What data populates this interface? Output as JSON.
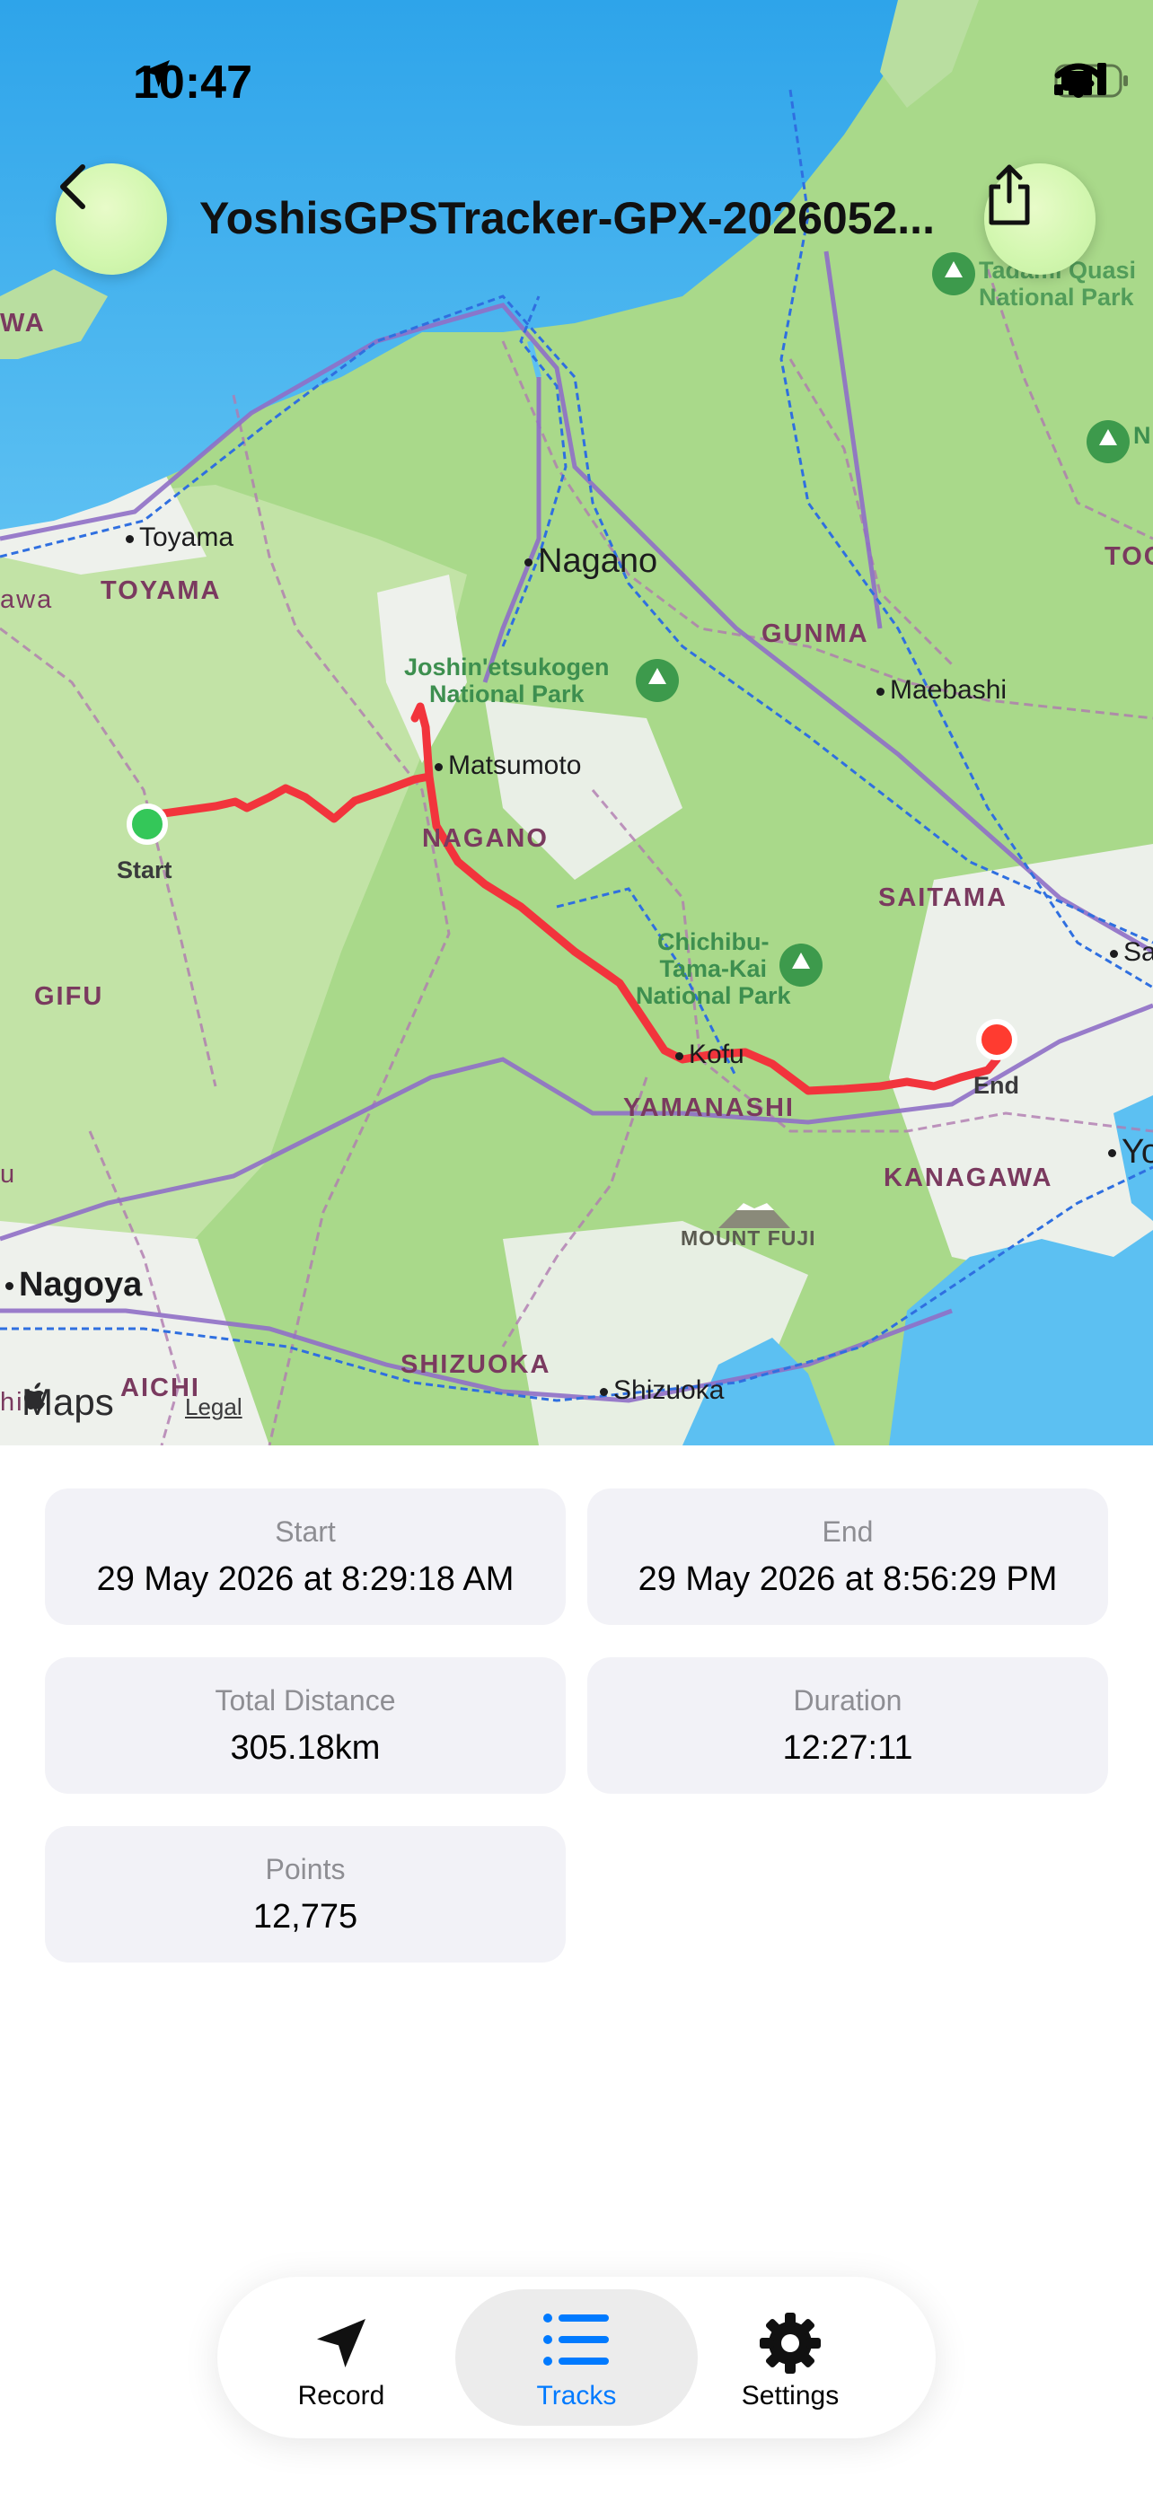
{
  "status": {
    "time": "10:47"
  },
  "header": {
    "title": "YoshisGPSTracker-GPX-2026052..."
  },
  "map": {
    "cities": {
      "toyama": "Toyama",
      "nagano": "Nagano",
      "maebashi": "Maebashi",
      "matsumoto": "Matsumoto",
      "kofu": "Kofu",
      "nagoya": "Nagoya",
      "shizuoka": "Shizuoka",
      "sa": "Sa",
      "yo": "Yo"
    },
    "prefectures": {
      "toyama": "TOYAMA",
      "awa": "awa",
      "wa": "WA",
      "gunma": "GUNMA",
      "nagano": "NAGANO",
      "saitama": "SAITAMA",
      "gifu": "GIFU",
      "yamanashi": "YAMANASHI",
      "kanagawa": "KANAGAWA",
      "shizuoka": "SHIZUOKA",
      "aichi": "AICHI",
      "toc": "TOC",
      "hi": "hi",
      "u": "u"
    },
    "parks": {
      "joshinetsu": "Joshin'etsukogen\nNational Park",
      "chichibu": "Chichibu-\nTama-Kai\nNational Park",
      "tadami": "Tadami Quasi\nNational Park",
      "n": "N"
    },
    "landmark": "MOUNT FUJI",
    "start_label": "Start",
    "end_label": "End",
    "attribution": "Maps",
    "legal": "Legal",
    "colors": {
      "route": "#f2343c",
      "start_pin": "#34c759",
      "end_pin": "#ff3b30"
    }
  },
  "stats": {
    "start": {
      "label": "Start",
      "value": "29 May 2026 at 8:29:18 AM"
    },
    "end": {
      "label": "End",
      "value": "29 May 2026 at 8:56:29 PM"
    },
    "distance": {
      "label": "Total Distance",
      "value": "305.18km"
    },
    "duration": {
      "label": "Duration",
      "value": "12:27:11"
    },
    "points": {
      "label": "Points",
      "value": "12,775"
    }
  },
  "tabs": [
    {
      "label": "Record",
      "icon": "location-arrow-icon",
      "selected": false
    },
    {
      "label": "Tracks",
      "icon": "list-icon",
      "selected": true
    },
    {
      "label": "Settings",
      "icon": "gear-icon",
      "selected": false
    }
  ],
  "accent": "#007aff"
}
